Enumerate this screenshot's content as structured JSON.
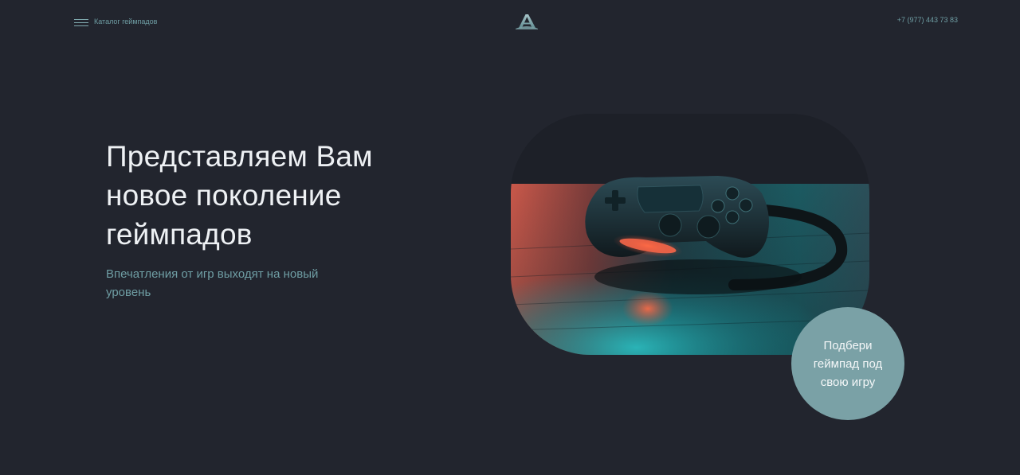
{
  "header": {
    "catalog_label": "Каталог геймпадов",
    "logo_icon": "triangle-a-logo-icon",
    "phone": "+7 (977) 443 73 83"
  },
  "hero": {
    "title": "Представляем Вам новое поколение геймпадов",
    "subtitle": "Впечатления от игр выходят на новый уровень",
    "image": "gamepad-on-table-photo",
    "cta_label": "Подбери геймпад под свою игру"
  },
  "colors": {
    "background": "#22252e",
    "accent": "#7aa1a6",
    "accent_text": "#6f9ea4",
    "title_text": "#eef1f4"
  }
}
